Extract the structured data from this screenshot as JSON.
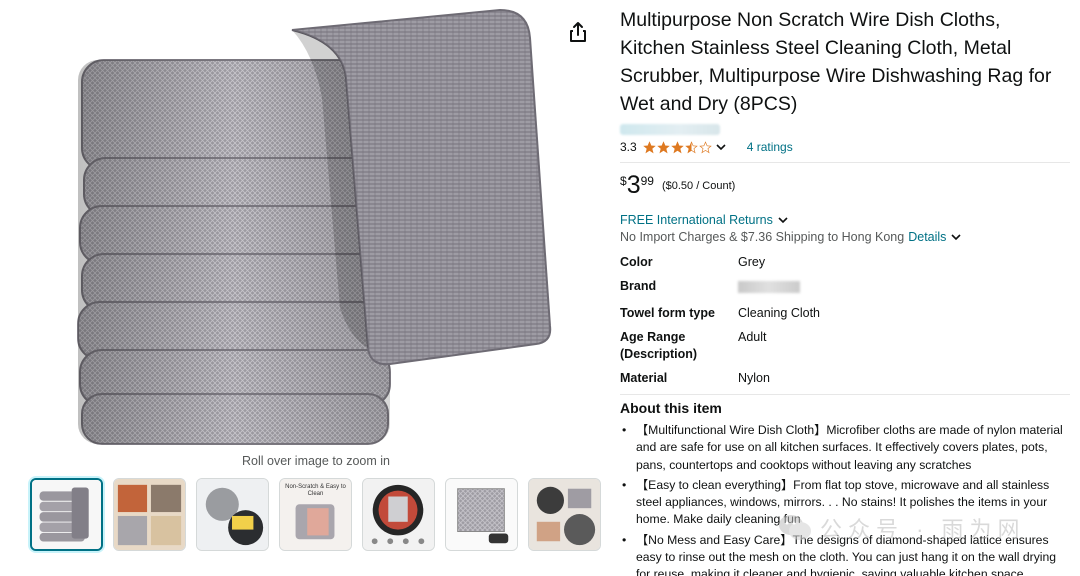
{
  "gallery": {
    "zoom_hint": "Roll over image to zoom in",
    "main_icon": "folded-steel-wire-cloth-stack",
    "share_icon": "share-icon",
    "thumbnails": [
      {
        "icon": "cloth-stack-thumbnail",
        "caption": ""
      },
      {
        "icon": "kitchen-use-thumbnail",
        "caption": ""
      },
      {
        "icon": "cleaning-pan-thumbnail",
        "caption": ""
      },
      {
        "icon": "no-scratch-thumbnail",
        "caption": "Non-Scratch & Easy to Clean"
      },
      {
        "icon": "pan-scrubbing-thumbnail",
        "caption": ""
      },
      {
        "icon": "mesh-detail-thumbnail",
        "caption": ""
      },
      {
        "icon": "stove-cleaning-thumbnail",
        "caption": ""
      }
    ]
  },
  "product": {
    "title": "Multipurpose Non Scratch Wire Dish Cloths, Kitchen Stainless Steel Cleaning Cloth, Metal Scrubber, Multipurpose Wire Dishwashing Rag for Wet and Dry (8PCS)",
    "rating_value": "3.3",
    "rating_stars": 3.5,
    "ratings_link": "4 ratings",
    "price": {
      "symbol": "$",
      "whole": "3",
      "fraction": "99",
      "unit": "($0.50 / Count)"
    },
    "returns_link": "FREE International Returns",
    "shipping_text": "No Import Charges & $7.36 Shipping to Hong Kong",
    "details_link": "Details"
  },
  "attributes": [
    {
      "key": "Color",
      "value": "Grey",
      "blurred": false
    },
    {
      "key": "Brand",
      "value": "",
      "blurred": true
    },
    {
      "key": "Towel form type",
      "value": "Cleaning Cloth",
      "blurred": false
    },
    {
      "key": "Age Range (Description)",
      "value": "Adult",
      "blurred": false
    },
    {
      "key": "Material",
      "value": "Nylon",
      "blurred": false
    }
  ],
  "about": {
    "heading": "About this item",
    "bullets": [
      "【Multifunctional Wire Dish Cloth】Microfiber cloths are made of nylon material and are safe for use on all kitchen surfaces. It effectively covers plates, pots, pans, countertops and cooktops without leaving any scratches",
      "【Easy to clean everything】From flat top stove, microwave and all stainless steel appliances, windows, mirrors. . . No stains! It polishes the items in your home. Make daily cleaning fun",
      "【No Mess and Easy Care】The designs of diamond-shaped lattice ensures easy to rinse out the mesh on the cloth. You can just hang it on the wall drying for reuse, making it cleaner and hygienic, saving valuable kitchen space"
    ]
  },
  "watermark": {
    "text": "公众号 · 雨为网",
    "icon": "wechat-icon"
  },
  "colors": {
    "link": "#007185",
    "star": "#de7921",
    "text": "#0f1111",
    "muted": "#565959"
  }
}
